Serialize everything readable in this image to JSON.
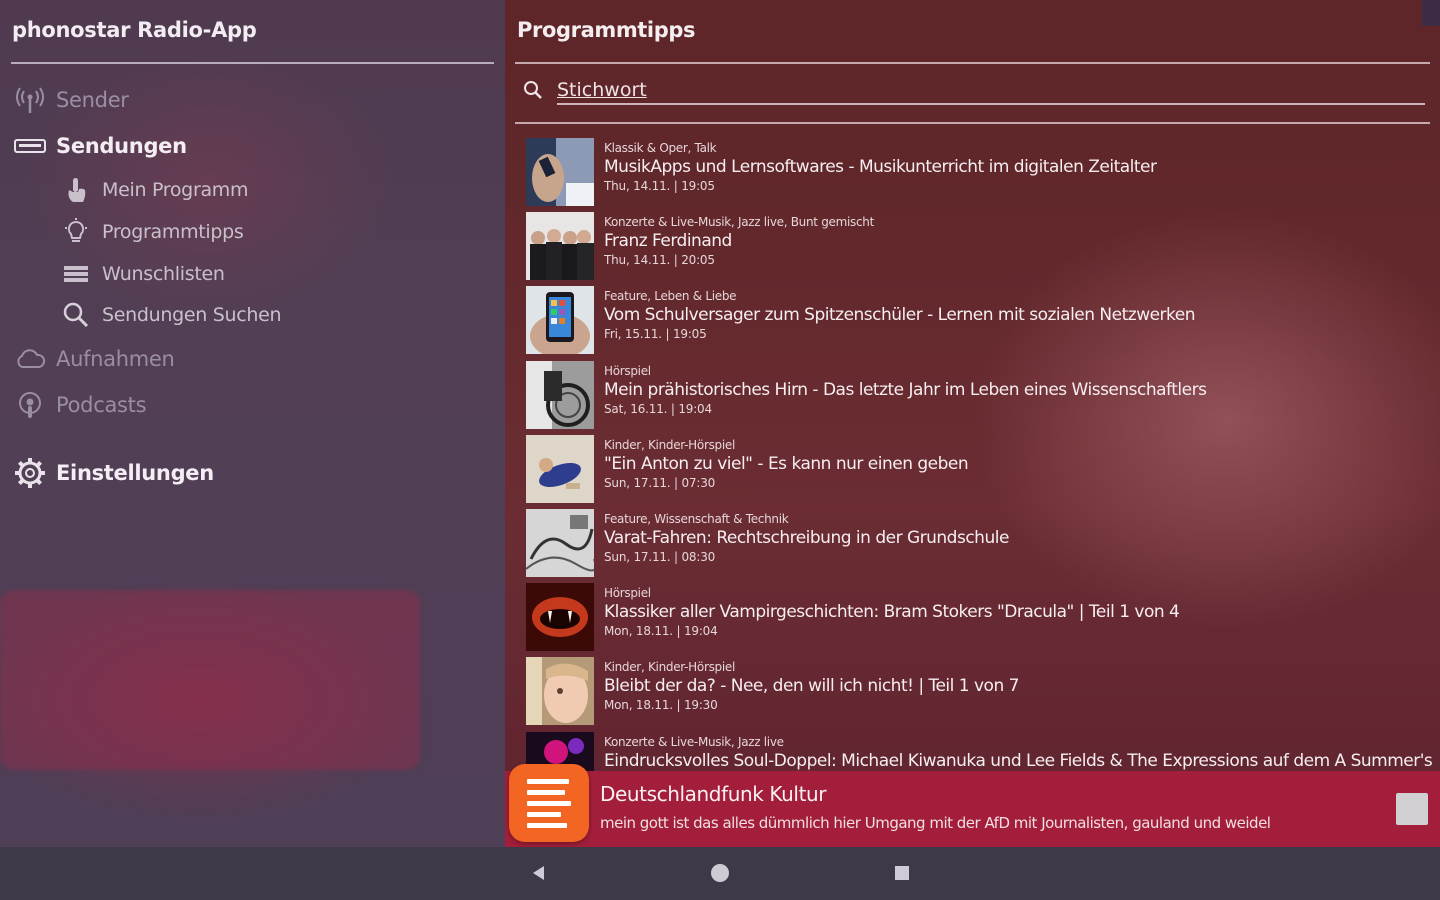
{
  "drawer": {
    "app_title": "phonostar Radio-App",
    "items": [
      {
        "label": "Sender",
        "icon": "radio-antenna-icon",
        "level": "top",
        "state": "dim"
      },
      {
        "label": "Sendungen",
        "icon": "keyboard-icon",
        "level": "top",
        "state": "bright"
      },
      {
        "label": "Mein Programm",
        "icon": "hand-touch-icon",
        "level": "sub",
        "state": "normal"
      },
      {
        "label": "Programmtipps",
        "icon": "lightbulb-icon",
        "level": "sub",
        "state": "normal"
      },
      {
        "label": "Wunschlisten",
        "icon": "list-icon",
        "level": "sub",
        "state": "normal"
      },
      {
        "label": "Sendungen Suchen",
        "icon": "search-icon",
        "level": "sub",
        "state": "normal"
      },
      {
        "label": "Aufnahmen",
        "icon": "cloud-icon",
        "level": "top",
        "state": "dim"
      },
      {
        "label": "Podcasts",
        "icon": "podcast-icon",
        "level": "top",
        "state": "dim"
      },
      {
        "label": "Einstellungen",
        "icon": "gear-icon",
        "level": "top",
        "state": "bright"
      }
    ]
  },
  "panel": {
    "title": "Programmtipps",
    "search_placeholder": "Stichwort",
    "items": [
      {
        "genre": "Klassik & Oper, Talk",
        "title": "MusikApps und Lernsoftwares - Musikunterricht im digitalen Zeitalter",
        "date": "Thu, 14.11. | 19:05",
        "thumb": "hands-phone"
      },
      {
        "genre": "Konzerte & Live-Musik, Jazz live, Bunt gemischt",
        "title": "Franz Ferdinand",
        "date": "Thu, 14.11. | 20:05",
        "thumb": "band"
      },
      {
        "genre": "Feature, Leben & Liebe",
        "title": "Vom Schulversager zum Spitzenschüler - Lernen mit sozialen Netzwerken",
        "date": "Fri, 15.11. | 19:05",
        "thumb": "smartphone"
      },
      {
        "genre": "Hörspiel",
        "title": "Mein prähistorisches Hirn - Das letzte Jahr im Leben eines Wissenschaftlers",
        "date": "Sat, 16.11. | 19:04",
        "thumb": "wheelchair"
      },
      {
        "genre": "Kinder, Kinder-Hörspiel",
        "title": "\"Ein Anton zu viel\" - Es kann nur einen geben",
        "date": "Sun, 17.11. | 07:30",
        "thumb": "child-floor"
      },
      {
        "genre": "Feature, Wissenschaft & Technik",
        "title": "Varat-Fahren: Rechtschreibung in der Grundschule",
        "date": "Sun, 17.11. | 08:30",
        "thumb": "sketch"
      },
      {
        "genre": "Hörspiel",
        "title": "Klassiker aller Vampirgeschichten: Bram Stokers \"Dracula\" | Teil 1 von 4",
        "date": "Mon, 18.11. | 19:04",
        "thumb": "vampire"
      },
      {
        "genre": "Kinder, Kinder-Hörspiel",
        "title": "Bleibt der da? - Nee, den will ich nicht! | Teil 1 von 7",
        "date": "Mon, 18.11. | 19:30",
        "thumb": "baby-face"
      },
      {
        "genre": "Konzerte & Live-Musik, Jazz live",
        "title": "Eindrucksvolles Soul-Doppel: Michael Kiwanuka und Lee Fields & The Expressions auf dem A Summer's",
        "date": "",
        "thumb": "concert"
      }
    ]
  },
  "player": {
    "station": "Deutschlandfunk Kultur",
    "subtitle": "mein gott ist das alles dümmlich hier Umgang mit der AfD mit Journalisten, gauland und weidel",
    "logo_icon": "deutschlandfunk-logo-icon",
    "stop_icon": "stop-icon"
  },
  "system_nav": {
    "icons": [
      "back-icon",
      "home-icon",
      "recents-icon"
    ]
  },
  "colors": {
    "drawer_bg": "#4f3a50",
    "panel_bg": "#62282c",
    "player_bg": "#a31e3a",
    "logo_orange": "#f26522",
    "navbar_bg": "#3d3949"
  }
}
